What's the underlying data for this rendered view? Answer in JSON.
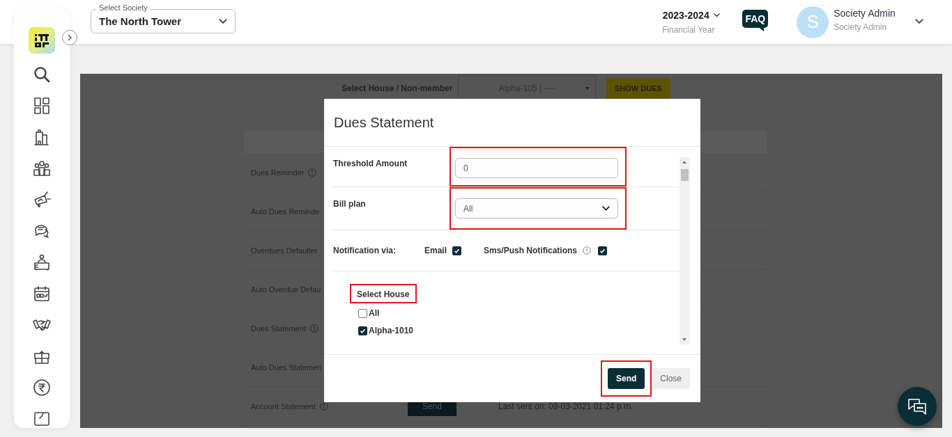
{
  "header": {
    "society_select": {
      "label": "Select Society",
      "value": "The North Tower"
    },
    "financial_year": {
      "value": "2023-2024",
      "label": "Financial Year"
    },
    "faq": "FAQ",
    "user": {
      "initial": "S",
      "name": "Society Admin",
      "role": "Society Admin"
    }
  },
  "filter": {
    "label": "Select House / Non-member",
    "house_select": "Alpha-105 | ----",
    "button": "SHOW DUES"
  },
  "table": {
    "rows": [
      {
        "label": "Dues Reminder",
        "info": true
      },
      {
        "label": "Auto Dues Reminde",
        "info": false
      },
      {
        "label": "Overdues Defaulter",
        "info": false
      },
      {
        "label": "Auto Overdue Defau",
        "info": false
      },
      {
        "label": "Dues Statement",
        "info": true
      },
      {
        "label": "Auto Dues Statemen",
        "info": false
      },
      {
        "label": "Account Statement",
        "info": true,
        "button": "Send",
        "last_sent": "Last sent on: 09-03-2021 01:24 p.m."
      }
    ]
  },
  "modal": {
    "title": "Dues Statement",
    "fields": [
      {
        "kind": "input",
        "label": "Threshold Amount",
        "value": "0",
        "highlighted": true
      },
      {
        "kind": "select",
        "label": "Bill plan",
        "value": "All",
        "highlighted": true
      }
    ],
    "notification": {
      "label": "Notification via:",
      "options": [
        {
          "label": "Email",
          "info": false,
          "checked": true
        },
        {
          "label": "Sms/Push Notifications",
          "info": true,
          "checked": true
        }
      ]
    },
    "house_list": {
      "title": "Select House",
      "highlighted": true,
      "items": [
        {
          "label": "All",
          "checked": false
        },
        {
          "label": "Alpha-1010",
          "checked": true
        }
      ]
    },
    "buttons": [
      {
        "kind": "primary",
        "label": "Send",
        "highlighted": true
      },
      {
        "kind": "secondary",
        "label": "Close",
        "highlighted": false
      }
    ]
  }
}
